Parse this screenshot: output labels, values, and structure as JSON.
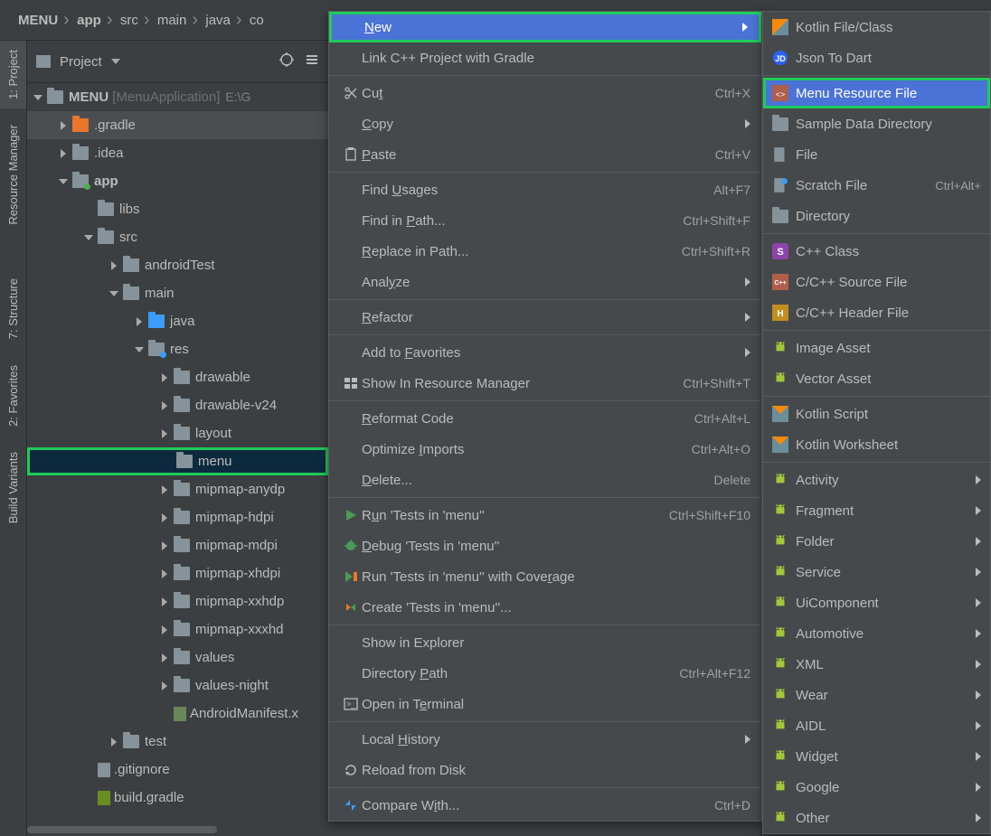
{
  "breadcrumb": [
    "MENU",
    "app",
    "src",
    "main",
    "java",
    "co"
  ],
  "project_header": {
    "title": "Project"
  },
  "rail_tabs": [
    "1: Project",
    "Resource Manager",
    "7: Structure",
    "2: Favorites",
    "Build Variants"
  ],
  "tree": {
    "root": {
      "name": "MENU",
      "bracketed": "[MenuApplication]",
      "path": "E:\\G"
    },
    "items": [
      {
        "label": ".gradle",
        "indent": 1,
        "icon": "folder-orange",
        "arrow": "right",
        "hover": true
      },
      {
        "label": ".idea",
        "indent": 1,
        "icon": "folder",
        "arrow": "right"
      },
      {
        "label": "app",
        "indent": 1,
        "icon": "folder-dot",
        "arrow": "down",
        "bold": true
      },
      {
        "label": "libs",
        "indent": 2,
        "icon": "folder"
      },
      {
        "label": "src",
        "indent": 2,
        "icon": "folder",
        "arrow": "down"
      },
      {
        "label": "androidTest",
        "indent": 3,
        "icon": "folder",
        "arrow": "right"
      },
      {
        "label": "main",
        "indent": 3,
        "icon": "folder",
        "arrow": "down"
      },
      {
        "label": "java",
        "indent": 4,
        "icon": "folder-blue",
        "arrow": "right"
      },
      {
        "label": "res",
        "indent": 4,
        "icon": "folder-blue-dot",
        "arrow": "down"
      },
      {
        "label": "drawable",
        "indent": 5,
        "icon": "folder",
        "arrow": "right"
      },
      {
        "label": "drawable-v24",
        "indent": 5,
        "icon": "folder",
        "arrow": "right"
      },
      {
        "label": "layout",
        "indent": 5,
        "icon": "folder",
        "arrow": "right"
      },
      {
        "label": "menu",
        "indent": 5,
        "icon": "folder",
        "selected": true
      },
      {
        "label": "mipmap-anydp",
        "indent": 5,
        "icon": "folder",
        "arrow": "right"
      },
      {
        "label": "mipmap-hdpi",
        "indent": 5,
        "icon": "folder",
        "arrow": "right"
      },
      {
        "label": "mipmap-mdpi",
        "indent": 5,
        "icon": "folder",
        "arrow": "right"
      },
      {
        "label": "mipmap-xhdpi",
        "indent": 5,
        "icon": "folder",
        "arrow": "right"
      },
      {
        "label": "mipmap-xxhdp",
        "indent": 5,
        "icon": "folder",
        "arrow": "right"
      },
      {
        "label": "mipmap-xxxhd",
        "indent": 5,
        "icon": "folder",
        "arrow": "right"
      },
      {
        "label": "values",
        "indent": 5,
        "icon": "folder",
        "arrow": "right"
      },
      {
        "label": "values-night",
        "indent": 5,
        "icon": "folder",
        "arrow": "right"
      },
      {
        "label": "AndroidManifest.x",
        "indent": 5,
        "icon": "file-manifest"
      },
      {
        "label": "test",
        "indent": 3,
        "icon": "folder",
        "arrow": "right"
      },
      {
        "label": ".gitignore",
        "indent": 2,
        "icon": "file-git"
      },
      {
        "label": "build.gradle",
        "indent": 2,
        "icon": "file-gradle"
      }
    ]
  },
  "ctx": [
    {
      "label": "New",
      "submenu": true,
      "highlighted": true,
      "u": 0
    },
    {
      "label": "Link C++ Project with Gradle"
    },
    {
      "sep": true
    },
    {
      "label": "Cut",
      "icon": "scissors",
      "shortcut": "Ctrl+X",
      "u": 2
    },
    {
      "label": "Copy",
      "submenu": true,
      "u": 0
    },
    {
      "label": "Paste",
      "icon": "clipboard",
      "shortcut": "Ctrl+V",
      "u": 0
    },
    {
      "sep": true
    },
    {
      "label": "Find Usages",
      "shortcut": "Alt+F7",
      "u": 5
    },
    {
      "label": "Find in Path...",
      "shortcut": "Ctrl+Shift+F",
      "u": 8
    },
    {
      "label": "Replace in Path...",
      "shortcut": "Ctrl+Shift+R",
      "u": 0
    },
    {
      "label": "Analyze",
      "submenu": true,
      "u": 4
    },
    {
      "sep": true
    },
    {
      "label": "Refactor",
      "submenu": true,
      "u": 0
    },
    {
      "sep": true
    },
    {
      "label": "Add to Favorites",
      "submenu": true,
      "u": 7
    },
    {
      "label": "Show In Resource Manager",
      "icon": "resmgr",
      "shortcut": "Ctrl+Shift+T"
    },
    {
      "sep": true
    },
    {
      "label": "Reformat Code",
      "shortcut": "Ctrl+Alt+L",
      "u": 0
    },
    {
      "label": "Optimize Imports",
      "shortcut": "Ctrl+Alt+O",
      "u": 9
    },
    {
      "label": "Delete...",
      "shortcut": "Delete",
      "u": 0
    },
    {
      "sep": true
    },
    {
      "label": "Run 'Tests in 'menu''",
      "icon": "run",
      "shortcut": "Ctrl+Shift+F10",
      "u": 1
    },
    {
      "label": "Debug 'Tests in 'menu''",
      "icon": "debug",
      "u": 0
    },
    {
      "label": "Run 'Tests in 'menu'' with Coverage",
      "icon": "coverage",
      "u": 31
    },
    {
      "label": "Create 'Tests in 'menu''...",
      "icon": "create"
    },
    {
      "sep": true
    },
    {
      "label": "Show in Explorer"
    },
    {
      "label": "Directory Path",
      "shortcut": "Ctrl+Alt+F12",
      "u": 10
    },
    {
      "label": "Open in Terminal",
      "icon": "terminal",
      "u": 9
    },
    {
      "sep": true
    },
    {
      "label": "Local History",
      "submenu": true,
      "u": 6
    },
    {
      "label": "Reload from Disk",
      "icon": "reload"
    },
    {
      "sep": true
    },
    {
      "label": "Compare With...",
      "icon": "compare",
      "shortcut": "Ctrl+D",
      "u": 9
    }
  ],
  "submenu": [
    {
      "label": "Kotlin File/Class",
      "icon": "kotlin"
    },
    {
      "label": "Json To Dart",
      "icon": "jd"
    },
    {
      "sep": true
    },
    {
      "label": "Menu Resource File",
      "icon": "xml",
      "highlighted": true
    },
    {
      "label": "Sample Data Directory",
      "icon": "folder"
    },
    {
      "label": "File",
      "icon": "file"
    },
    {
      "label": "Scratch File",
      "icon": "scratch",
      "shortcut": "Ctrl+Alt+"
    },
    {
      "label": "Directory",
      "icon": "folder"
    },
    {
      "sep": true
    },
    {
      "label": "C++ Class",
      "icon": "cpp-s"
    },
    {
      "label": "C/C++ Source File",
      "icon": "cpp"
    },
    {
      "label": "C/C++ Header File",
      "icon": "hpp"
    },
    {
      "sep": true
    },
    {
      "label": "Image Asset",
      "icon": "android"
    },
    {
      "label": "Vector Asset",
      "icon": "android"
    },
    {
      "sep": true
    },
    {
      "label": "Kotlin Script",
      "icon": "kotlin-sc"
    },
    {
      "label": "Kotlin Worksheet",
      "icon": "kotlin-ws"
    },
    {
      "sep": true
    },
    {
      "label": "Activity",
      "icon": "android",
      "submenu": true
    },
    {
      "label": "Fragment",
      "icon": "android",
      "submenu": true
    },
    {
      "label": "Folder",
      "icon": "android",
      "submenu": true
    },
    {
      "label": "Service",
      "icon": "android",
      "submenu": true
    },
    {
      "label": "UiComponent",
      "icon": "android",
      "submenu": true
    },
    {
      "label": "Automotive",
      "icon": "android",
      "submenu": true
    },
    {
      "label": "XML",
      "icon": "android",
      "submenu": true
    },
    {
      "label": "Wear",
      "icon": "android",
      "submenu": true
    },
    {
      "label": "AIDL",
      "icon": "android",
      "submenu": true
    },
    {
      "label": "Widget",
      "icon": "android",
      "submenu": true
    },
    {
      "label": "Google",
      "icon": "android",
      "submenu": true
    },
    {
      "label": "Other",
      "icon": "android",
      "submenu": true
    }
  ]
}
